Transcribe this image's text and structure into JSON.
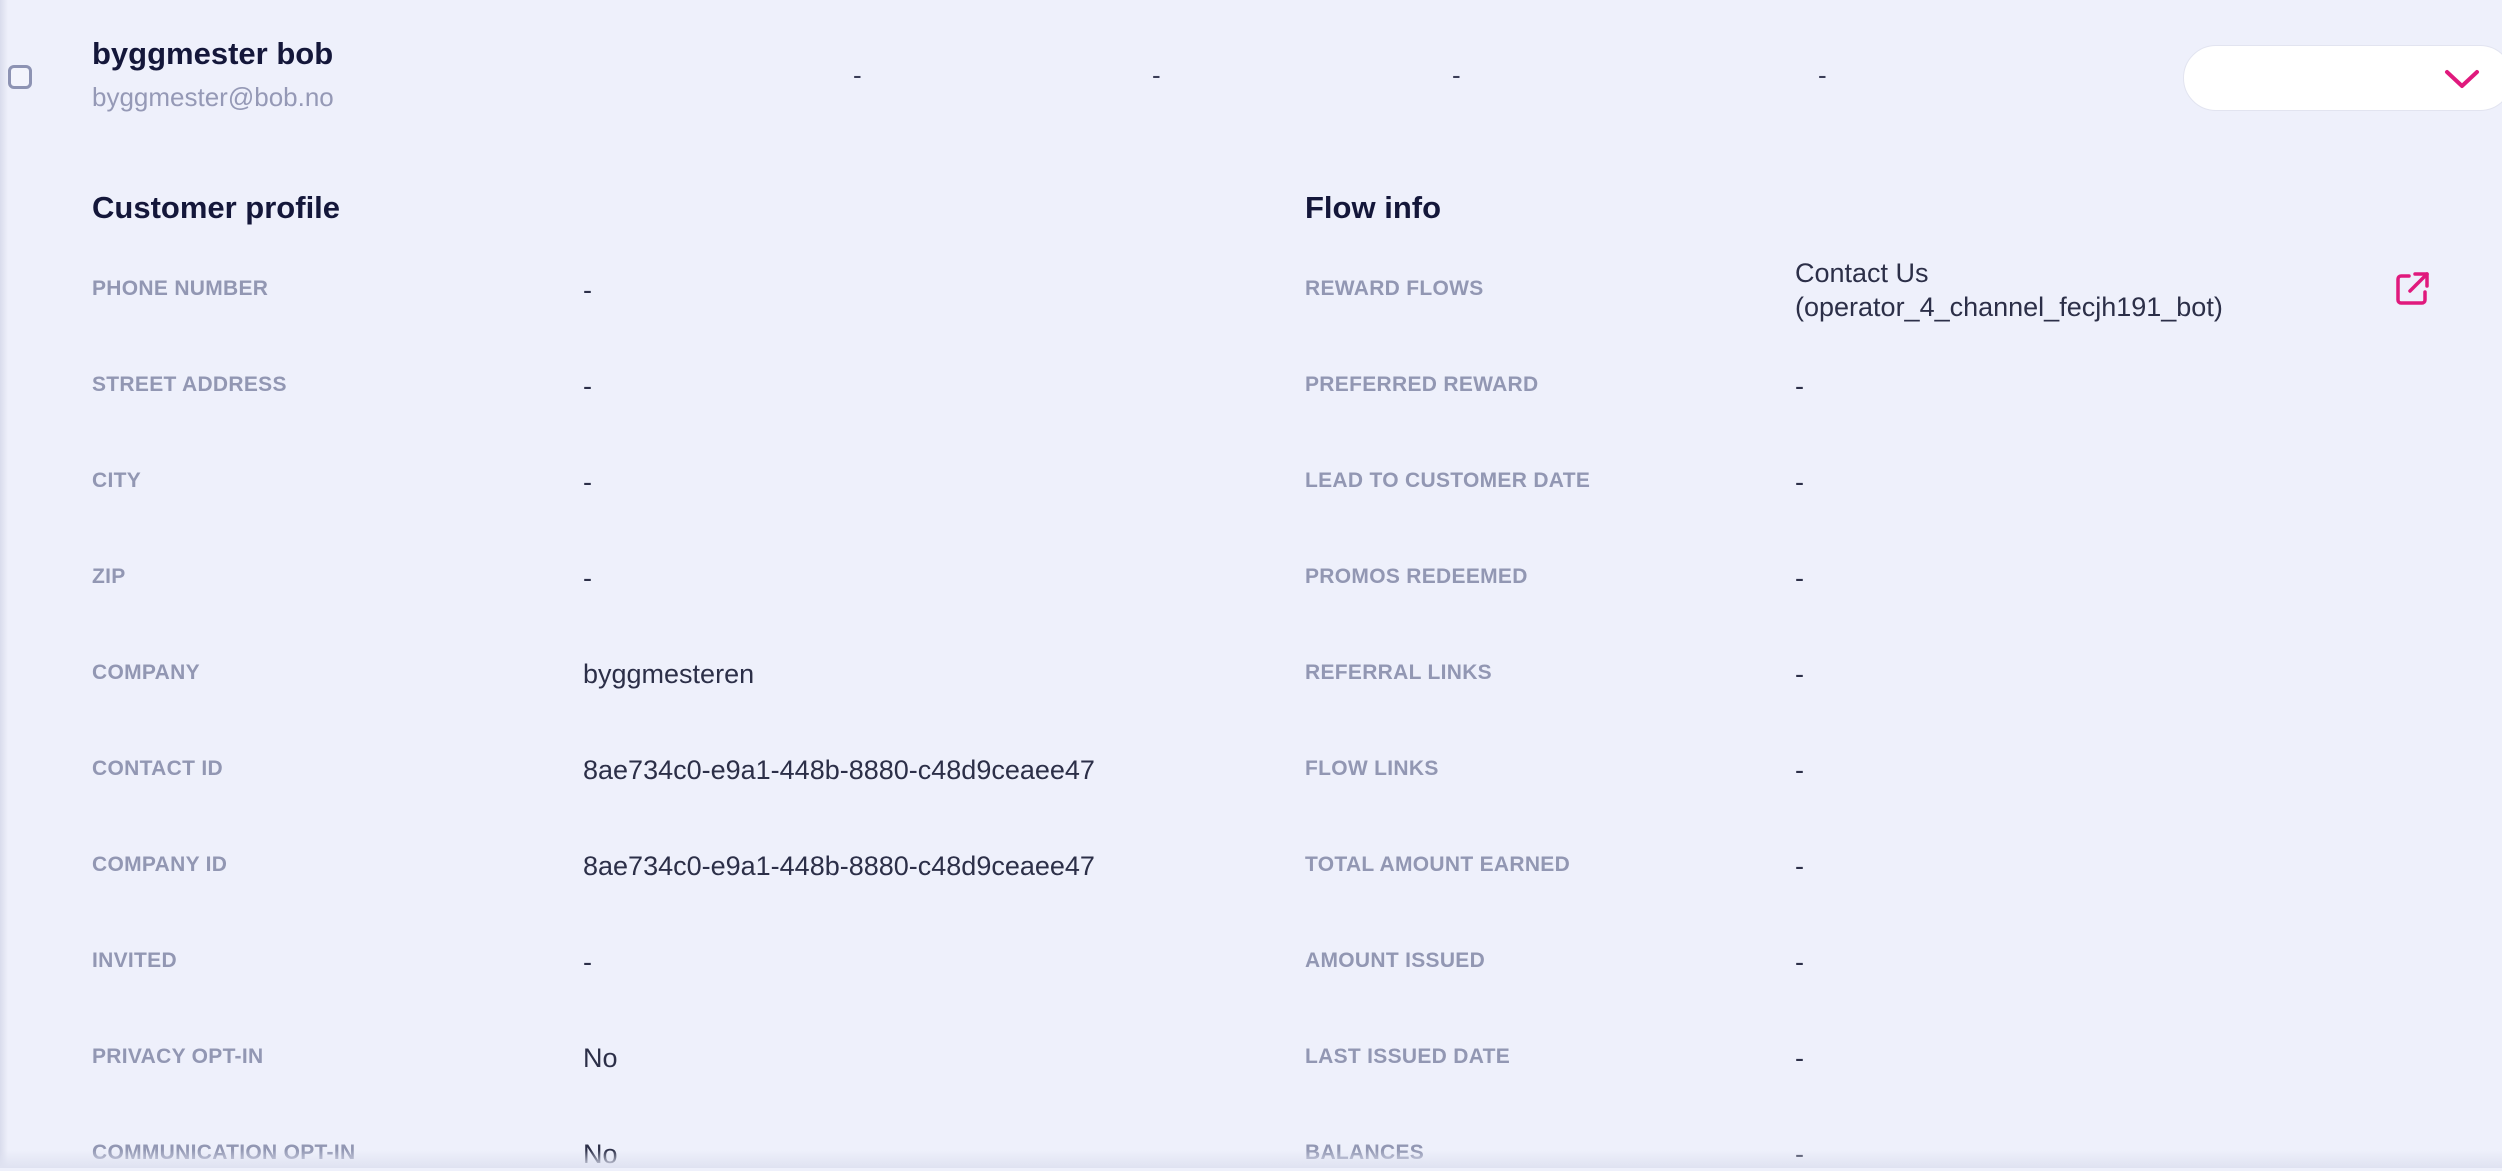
{
  "user": {
    "name": "byggmester bob",
    "email": "byggmester@bob.no"
  },
  "summary": [
    "-",
    "-",
    "-",
    "-"
  ],
  "colors": {
    "accent": "#e0197d",
    "background": "#eef0fb"
  },
  "customer_profile": {
    "title": "Customer profile",
    "fields": [
      {
        "label": "PHONE NUMBER",
        "value": "-"
      },
      {
        "label": "STREET ADDRESS",
        "value": "-"
      },
      {
        "label": "CITY",
        "value": "-"
      },
      {
        "label": "ZIP",
        "value": "-"
      },
      {
        "label": "COMPANY",
        "value": "byggmesteren"
      },
      {
        "label": "CONTACT ID",
        "value": "8ae734c0-e9a1-448b-8880-c48d9ceaee47"
      },
      {
        "label": "COMPANY ID",
        "value": "8ae734c0-e9a1-448b-8880-c48d9ceaee47"
      },
      {
        "label": "INVITED",
        "value": "-"
      },
      {
        "label": "PRIVACY OPT-IN",
        "value": "No"
      },
      {
        "label": "COMMUNICATION OPT-IN",
        "value": "No"
      }
    ]
  },
  "flow_info": {
    "title": "Flow info",
    "reward_flow": {
      "label": "REWARD FLOWS",
      "value_line1": "Contact Us",
      "value_line2": "(operator_4_channel_fecjh191_bot)",
      "link_icon": "external-link-icon"
    },
    "fields": [
      {
        "label": "PREFERRED REWARD",
        "value": "-"
      },
      {
        "label": "LEAD TO CUSTOMER DATE",
        "value": "-"
      },
      {
        "label": "PROMOS REDEEMED",
        "value": "-"
      },
      {
        "label": "REFERRAL LINKS",
        "value": "-"
      },
      {
        "label": "FLOW LINKS",
        "value": "-"
      },
      {
        "label": "TOTAL AMOUNT EARNED",
        "value": "-"
      },
      {
        "label": "AMOUNT ISSUED",
        "value": "-"
      },
      {
        "label": "LAST ISSUED DATE",
        "value": "-"
      },
      {
        "label": "BALANCES",
        "value": "-"
      }
    ]
  },
  "status_select": {
    "icon": "chevron-down-icon"
  }
}
